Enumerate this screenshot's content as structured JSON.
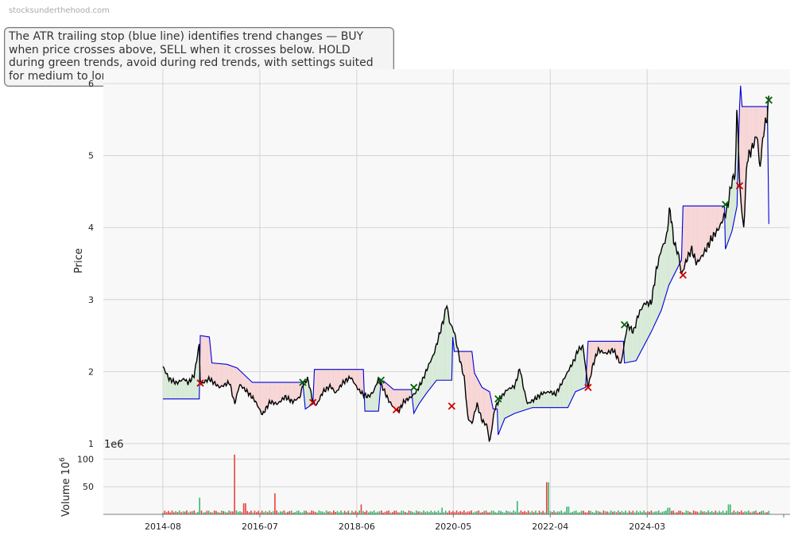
{
  "watermark": "stocksunderthehood.com",
  "annotation": "The ATR trailing stop (blue line) identifies trend changes — BUY when price crosses above, SELL when it crosses below. HOLD during green trends, avoid during red trends, with settings suited for medium to long-term investors.",
  "colors": {
    "price": "#000000",
    "stop": "#0000dd",
    "up_fill": "#d6e9d6",
    "down_fill": "#f7d4d4",
    "buy": "#006400",
    "sell": "#cc0000",
    "vol_up": "#3cb371",
    "vol_down": "#e8413c",
    "grid": "#cccccc",
    "panel_bg": "#f8f8f8"
  },
  "chart_data": [
    {
      "type": "line",
      "ylabel": "Price",
      "ylim": [
        0.9,
        6.2
      ],
      "yticks": [
        1,
        2,
        3,
        4,
        5,
        6
      ],
      "x_range": [
        2013.4,
        2027.0
      ],
      "xtick_labels": [
        "2014-08",
        "2016-07",
        "2018-06",
        "2020-05",
        "2022-04",
        "2024-03"
      ],
      "xtick_values": [
        2014.58,
        2016.5,
        2018.42,
        2020.33,
        2022.25,
        2024.17
      ],
      "grid": true,
      "price": [
        [
          2014.58,
          2.07
        ],
        [
          2014.7,
          1.9
        ],
        [
          2014.85,
          1.84
        ],
        [
          2015.0,
          1.9
        ],
        [
          2015.08,
          1.84
        ],
        [
          2015.2,
          1.95
        ],
        [
          2015.3,
          2.38
        ],
        [
          2015.32,
          1.82
        ],
        [
          2015.5,
          1.9
        ],
        [
          2015.7,
          1.78
        ],
        [
          2015.9,
          1.85
        ],
        [
          2016.0,
          1.55
        ],
        [
          2016.1,
          1.82
        ],
        [
          2016.25,
          1.72
        ],
        [
          2016.4,
          1.6
        ],
        [
          2016.55,
          1.4
        ],
        [
          2016.7,
          1.58
        ],
        [
          2016.85,
          1.55
        ],
        [
          2017.0,
          1.65
        ],
        [
          2017.15,
          1.58
        ],
        [
          2017.3,
          1.65
        ],
        [
          2017.35,
          1.82
        ],
        [
          2017.45,
          1.9
        ],
        [
          2017.55,
          1.58
        ],
        [
          2017.62,
          1.53
        ],
        [
          2017.75,
          1.72
        ],
        [
          2017.9,
          1.8
        ],
        [
          2018.0,
          1.7
        ],
        [
          2018.15,
          1.85
        ],
        [
          2018.3,
          1.92
        ],
        [
          2018.45,
          1.75
        ],
        [
          2018.55,
          1.68
        ],
        [
          2018.65,
          1.65
        ],
        [
          2018.75,
          1.72
        ],
        [
          2018.85,
          1.9
        ],
        [
          2018.95,
          1.75
        ],
        [
          2019.05,
          1.6
        ],
        [
          2019.15,
          1.5
        ],
        [
          2019.25,
          1.45
        ],
        [
          2019.35,
          1.58
        ],
        [
          2019.5,
          1.65
        ],
        [
          2019.6,
          1.72
        ],
        [
          2019.72,
          1.88
        ],
        [
          2019.85,
          2.1
        ],
        [
          2019.95,
          2.25
        ],
        [
          2020.05,
          2.5
        ],
        [
          2020.15,
          2.75
        ],
        [
          2020.2,
          2.95
        ],
        [
          2020.25,
          2.7
        ],
        [
          2020.35,
          2.55
        ],
        [
          2020.45,
          2.2
        ],
        [
          2020.55,
          1.9
        ],
        [
          2020.62,
          1.35
        ],
        [
          2020.7,
          1.28
        ],
        [
          2020.8,
          1.55
        ],
        [
          2020.9,
          1.32
        ],
        [
          2021.0,
          1.25
        ],
        [
          2021.05,
          1.0
        ],
        [
          2021.15,
          1.48
        ],
        [
          2021.25,
          1.62
        ],
        [
          2021.4,
          1.75
        ],
        [
          2021.55,
          1.8
        ],
        [
          2021.65,
          2.05
        ],
        [
          2021.72,
          1.78
        ],
        [
          2021.8,
          1.55
        ],
        [
          2021.95,
          1.62
        ],
        [
          2022.1,
          1.7
        ],
        [
          2022.25,
          1.72
        ],
        [
          2022.35,
          1.68
        ],
        [
          2022.45,
          1.8
        ],
        [
          2022.6,
          2.0
        ],
        [
          2022.72,
          2.15
        ],
        [
          2022.8,
          2.3
        ],
        [
          2022.9,
          2.35
        ],
        [
          2023.0,
          1.78
        ],
        [
          2023.1,
          2.1
        ],
        [
          2023.2,
          2.3
        ],
        [
          2023.35,
          2.25
        ],
        [
          2023.5,
          2.3
        ],
        [
          2023.65,
          2.1
        ],
        [
          2023.78,
          2.65
        ],
        [
          2023.9,
          2.55
        ],
        [
          2024.0,
          2.8
        ],
        [
          2024.12,
          2.95
        ],
        [
          2024.25,
          2.95
        ],
        [
          2024.35,
          3.4
        ],
        [
          2024.45,
          3.7
        ],
        [
          2024.55,
          3.85
        ],
        [
          2024.62,
          4.28
        ],
        [
          2024.7,
          3.8
        ],
        [
          2024.8,
          3.6
        ],
        [
          2024.85,
          3.34
        ],
        [
          2024.95,
          3.55
        ],
        [
          2025.05,
          3.7
        ],
        [
          2025.15,
          3.5
        ],
        [
          2025.3,
          3.65
        ],
        [
          2025.45,
          3.85
        ],
        [
          2025.6,
          4.0
        ],
        [
          2025.75,
          4.25
        ],
        [
          2025.85,
          4.65
        ],
        [
          2025.92,
          4.75
        ],
        [
          2025.95,
          5.78
        ],
        [
          2026.0,
          4.6
        ],
        [
          2026.08,
          3.95
        ],
        [
          2026.15,
          4.95
        ],
        [
          2026.25,
          5.1
        ],
        [
          2026.35,
          5.3
        ],
        [
          2026.4,
          4.8
        ],
        [
          2026.48,
          5.35
        ],
        [
          2026.55,
          5.55
        ],
        [
          2026.58,
          5.78
        ]
      ],
      "atr_stop": [
        [
          2014.58,
          1.62
        ],
        [
          2015.0,
          1.62
        ],
        [
          2015.3,
          1.62
        ],
        [
          2015.32,
          2.5
        ],
        [
          2015.5,
          2.48
        ],
        [
          2015.55,
          2.12
        ],
        [
          2015.85,
          2.1
        ],
        [
          2016.05,
          2.05
        ],
        [
          2016.2,
          1.95
        ],
        [
          2016.35,
          1.85
        ],
        [
          2017.35,
          1.85
        ],
        [
          2017.4,
          1.48
        ],
        [
          2017.55,
          1.55
        ],
        [
          2017.58,
          2.03
        ],
        [
          2018.55,
          2.03
        ],
        [
          2018.58,
          1.45
        ],
        [
          2018.85,
          1.45
        ],
        [
          2018.9,
          1.87
        ],
        [
          2018.95,
          1.87
        ],
        [
          2019.15,
          1.75
        ],
        [
          2019.5,
          1.75
        ],
        [
          2019.55,
          1.42
        ],
        [
          2019.65,
          1.55
        ],
        [
          2019.8,
          1.7
        ],
        [
          2020.0,
          1.88
        ],
        [
          2020.3,
          1.88
        ],
        [
          2020.32,
          2.48
        ],
        [
          2020.35,
          2.28
        ],
        [
          2020.7,
          2.28
        ],
        [
          2020.75,
          1.98
        ],
        [
          2020.9,
          1.78
        ],
        [
          2021.05,
          1.72
        ],
        [
          2021.12,
          1.48
        ],
        [
          2021.2,
          1.48
        ],
        [
          2021.22,
          1.12
        ],
        [
          2021.35,
          1.35
        ],
        [
          2021.55,
          1.42
        ],
        [
          2021.9,
          1.5
        ],
        [
          2022.6,
          1.5
        ],
        [
          2022.75,
          1.72
        ],
        [
          2022.95,
          1.78
        ],
        [
          2023.0,
          2.42
        ],
        [
          2023.7,
          2.42
        ],
        [
          2023.72,
          2.12
        ],
        [
          2023.95,
          2.15
        ],
        [
          2024.1,
          2.35
        ],
        [
          2024.25,
          2.55
        ],
        [
          2024.45,
          2.85
        ],
        [
          2024.6,
          3.2
        ],
        [
          2024.85,
          3.55
        ],
        [
          2024.88,
          4.3
        ],
        [
          2025.7,
          4.3
        ],
        [
          2025.72,
          3.7
        ],
        [
          2025.85,
          3.95
        ],
        [
          2025.95,
          4.3
        ],
        [
          2026.0,
          5.68
        ],
        [
          2026.02,
          5.97
        ],
        [
          2026.05,
          5.68
        ],
        [
          2026.55,
          5.68
        ],
        [
          2026.58,
          4.05
        ]
      ],
      "buy_signals": [
        [
          2017.35,
          1.85
        ],
        [
          2018.9,
          1.88
        ],
        [
          2019.55,
          1.78
        ],
        [
          2021.22,
          1.62
        ],
        [
          2023.72,
          2.65
        ],
        [
          2025.72,
          4.32
        ],
        [
          2026.58,
          5.77
        ]
      ],
      "sell_signals": [
        [
          2015.32,
          1.84
        ],
        [
          2017.55,
          1.57
        ],
        [
          2019.2,
          1.47
        ],
        [
          2020.3,
          1.52
        ],
        [
          2023.0,
          1.78
        ],
        [
          2024.88,
          3.34
        ],
        [
          2026.0,
          4.58
        ]
      ]
    },
    {
      "type": "bar",
      "ylabel": "Volume  10",
      "ylabel_superscript": "6",
      "offset_label": "1e6",
      "yticks": [
        50,
        100
      ],
      "ylim": [
        0,
        115
      ],
      "spikes": [
        [
          2015.3,
          30
        ],
        [
          2016.0,
          108
        ],
        [
          2016.2,
          20
        ],
        [
          2016.8,
          38
        ],
        [
          2018.5,
          18
        ],
        [
          2020.1,
          12
        ],
        [
          2021.6,
          24
        ],
        [
          2022.2,
          58
        ],
        [
          2022.6,
          14
        ],
        [
          2024.6,
          12
        ],
        [
          2025.8,
          18
        ]
      ]
    }
  ]
}
